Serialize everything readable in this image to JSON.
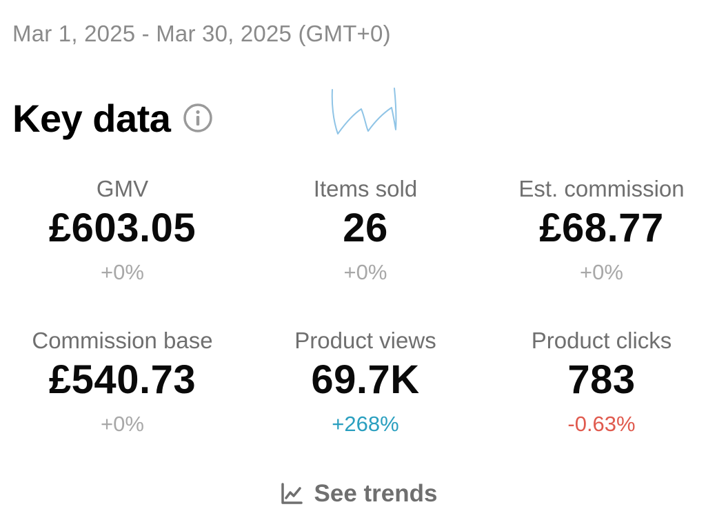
{
  "date_range": "Mar 1, 2025 - Mar 30, 2025 (GMT+0)",
  "key_data": {
    "title": "Key data",
    "info_icon": "info-icon"
  },
  "metrics": [
    {
      "label": "GMV",
      "value": "£603.05",
      "change": "+0%",
      "trend": "neutral"
    },
    {
      "label": "Items sold",
      "value": "26",
      "change": "+0%",
      "trend": "neutral"
    },
    {
      "label": "Est. commission",
      "value": "£68.77",
      "change": "+0%",
      "trend": "neutral"
    },
    {
      "label": "Commission base",
      "value": "£540.73",
      "change": "+0%",
      "trend": "neutral"
    },
    {
      "label": "Product views",
      "value": "69.7K",
      "change": "+268%",
      "trend": "up"
    },
    {
      "label": "Product clicks",
      "value": "783",
      "change": "-0.63%",
      "trend": "down"
    }
  ],
  "see_trends": {
    "label": "See trends",
    "icon": "line-chart-icon"
  },
  "colors": {
    "change_neutral": "#a8a8a8",
    "change_up": "#2a9fbf",
    "change_down": "#e05a4e",
    "scribble": "#8fc4e6"
  }
}
